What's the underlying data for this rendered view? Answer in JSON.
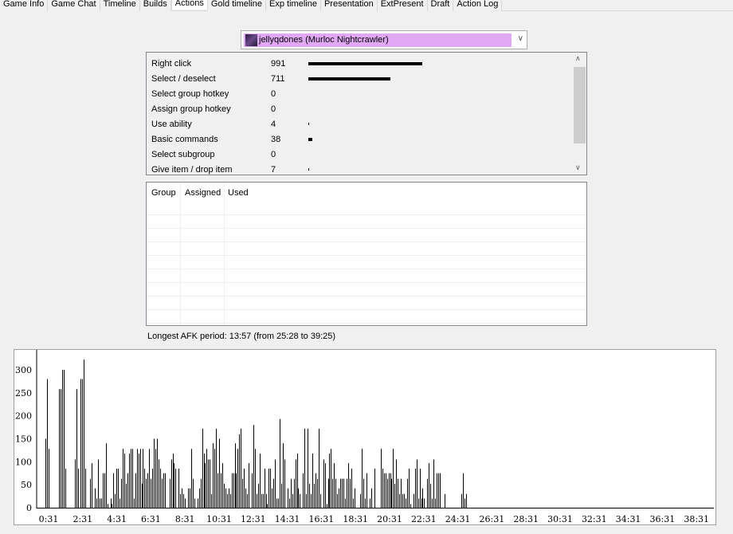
{
  "tabs": [
    {
      "label": "Game Info",
      "active": false
    },
    {
      "label": "Game Chat",
      "active": false
    },
    {
      "label": "Timeline",
      "active": false
    },
    {
      "label": "Builds",
      "active": false
    },
    {
      "label": "Actions",
      "active": true
    },
    {
      "label": "Gold timeline",
      "active": false
    },
    {
      "label": "Exp timeline",
      "active": false
    },
    {
      "label": "Presentation",
      "active": false
    },
    {
      "label": "ExtPresent",
      "active": false
    },
    {
      "label": "Draft",
      "active": false
    },
    {
      "label": "Action Log",
      "active": false
    }
  ],
  "player_select": {
    "value": "jellyqdones (Murloc Nightcrawler)",
    "highlight_color": "#e1a8f6",
    "icon": "hero-portrait-icon"
  },
  "actions": [
    {
      "label": "Right click",
      "value": 991
    },
    {
      "label": "Select / deselect",
      "value": 711
    },
    {
      "label": "Select group hotkey",
      "value": 0
    },
    {
      "label": "Assign group hotkey",
      "value": 0
    },
    {
      "label": "Use ability",
      "value": 4
    },
    {
      "label": "Basic commands",
      "value": 38
    },
    {
      "label": "Select subgroup",
      "value": 0
    },
    {
      "label": "Give item / drop item",
      "value": 7
    }
  ],
  "groups_table": {
    "columns": [
      "Group",
      "Assigned",
      "Used"
    ],
    "rows": []
  },
  "afk_text": "Longest AFK period: 13:57 (from 25:28 to 39:25)",
  "chart_data": {
    "type": "bar",
    "ylim": [
      0,
      330
    ],
    "y_ticks": [
      "0",
      "50",
      "100",
      "150",
      "200",
      "250",
      "300"
    ],
    "x_ticks": [
      "0:31",
      "2:31",
      "4:31",
      "6:31",
      "8:31",
      "10:31",
      "12:31",
      "14:31",
      "16:31",
      "18:31",
      "20:31",
      "22:31",
      "24:31",
      "26:31",
      "28:31",
      "30:31",
      "32:31",
      "34:31",
      "36:31",
      "38:31"
    ],
    "values": [
      150,
      280,
      128,
      0,
      0,
      0,
      0,
      0,
      0,
      258,
      258,
      300,
      300,
      85,
      0,
      0,
      0,
      0,
      0,
      105,
      258,
      85,
      0,
      280,
      280,
      322,
      85,
      0,
      0,
      63,
      97,
      0,
      42,
      20,
      105,
      20,
      20,
      75,
      75,
      140,
      8,
      0,
      20,
      8,
      75,
      30,
      85,
      85,
      20,
      63,
      128,
      118,
      52,
      75,
      118,
      128,
      128,
      20,
      75,
      128,
      118,
      128,
      52,
      128,
      85,
      63,
      75,
      128,
      63,
      85,
      150,
      128,
      150,
      105,
      85,
      63,
      75,
      75,
      0,
      0,
      63,
      105,
      118,
      97,
      85,
      0,
      85,
      30,
      42,
      30,
      20,
      0,
      42,
      42,
      128,
      63,
      20,
      0,
      20,
      42,
      63,
      172,
      118,
      97,
      128,
      105,
      105,
      30,
      140,
      128,
      172,
      75,
      150,
      75,
      97,
      52,
      42,
      30,
      42,
      30,
      75,
      75,
      140,
      75,
      128,
      160,
      172,
      63,
      85,
      42,
      30,
      97,
      0,
      75,
      180,
      128,
      30,
      52,
      118,
      30,
      30,
      85,
      30,
      8,
      85,
      85,
      42,
      63,
      105,
      20,
      20,
      193,
      52,
      140,
      105,
      0,
      42,
      20,
      63,
      30,
      63,
      105,
      118,
      42,
      30,
      0,
      75,
      172,
      30,
      172,
      52,
      30,
      118,
      52,
      75,
      63,
      172,
      30,
      0,
      105,
      97,
      8,
      63,
      118,
      128,
      63,
      97,
      63,
      30,
      42,
      63,
      63,
      63,
      20,
      63,
      97,
      63,
      85,
      20,
      42,
      0,
      0,
      0,
      30,
      128,
      63,
      20,
      75,
      0,
      20,
      42,
      0,
      85,
      0,
      0,
      0,
      128,
      85,
      75,
      75,
      63,
      75,
      75,
      63,
      128,
      52,
      105,
      63,
      30,
      63,
      30,
      30,
      20,
      63,
      85,
      8,
      0,
      30,
      85,
      105,
      20,
      85,
      20,
      42,
      20,
      0,
      63,
      97,
      52,
      20,
      105,
      20,
      75,
      75,
      75,
      0,
      0,
      30,
      0,
      0,
      0,
      0,
      0,
      0,
      0,
      0,
      0,
      0,
      30,
      75,
      20,
      30
    ]
  }
}
